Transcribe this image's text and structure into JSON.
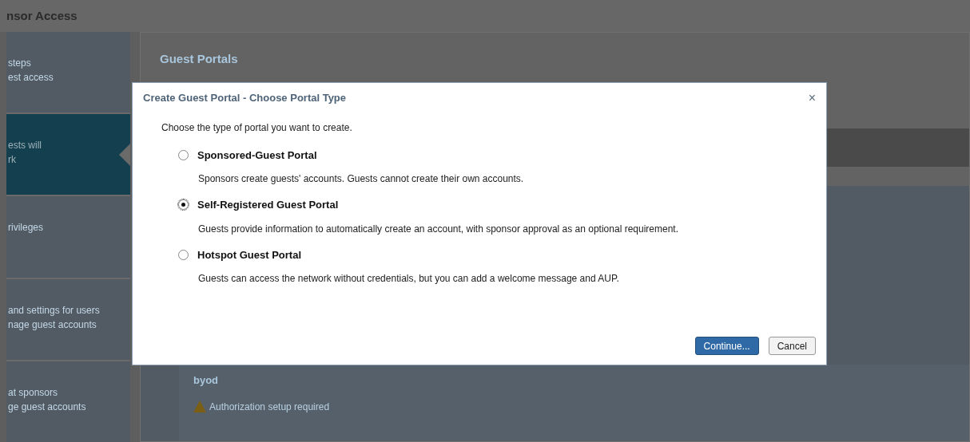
{
  "header": {
    "title": "nsor Access"
  },
  "sidebar": {
    "items": [
      {
        "lines": [
          "steps",
          "est access"
        ],
        "selected": false
      },
      {
        "lines": [
          "ests will",
          "rk"
        ],
        "selected": true
      },
      {
        "lines": [
          "rivileges"
        ],
        "selected": false
      },
      {
        "lines": [
          "and settings for users",
          "nage guest accounts"
        ],
        "selected": false
      },
      {
        "lines": [
          "at sponsors",
          "ge guest accounts"
        ],
        "selected": false
      }
    ]
  },
  "main": {
    "title": "Guest Portals",
    "portal": {
      "name": "byod",
      "warning": "Authorization setup required"
    }
  },
  "dialog": {
    "title": "Create Guest Portal - Choose Portal Type",
    "close": "×",
    "intro": "Choose the type of portal you want to create.",
    "options": [
      {
        "label": "Sponsored-Guest Portal",
        "description": "Sponsors create guests' accounts. Guests cannot create their own accounts.",
        "selected": false
      },
      {
        "label": "Self-Registered Guest Portal",
        "description": "Guests provide information to automatically create an account, with sponsor approval as an optional requirement.",
        "selected": true
      },
      {
        "label": "Hotspot Guest Portal",
        "description": "Guests can access the network without credentials, but you can add a welcome message and AUP.",
        "selected": false
      }
    ],
    "buttons": [
      {
        "label": "Continue...",
        "kind": "primary"
      },
      {
        "label": "Cancel",
        "kind": "secondary"
      }
    ]
  }
}
